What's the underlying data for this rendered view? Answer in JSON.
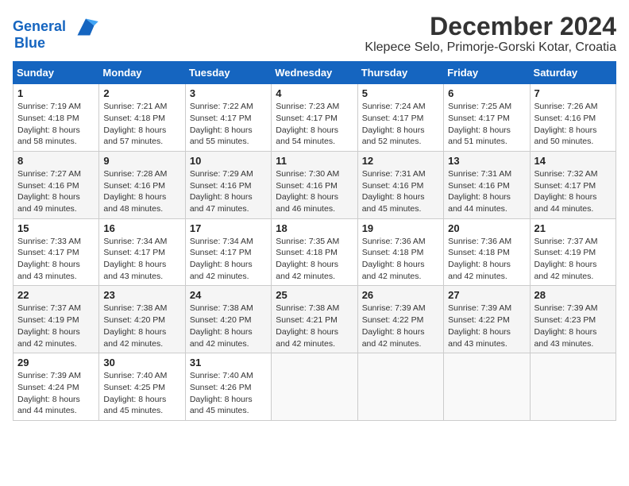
{
  "header": {
    "logo_line1": "General",
    "logo_line2": "Blue",
    "title": "December 2024",
    "subtitle": "Klepece Selo, Primorje-Gorski Kotar, Croatia"
  },
  "days_of_week": [
    "Sunday",
    "Monday",
    "Tuesday",
    "Wednesday",
    "Thursday",
    "Friday",
    "Saturday"
  ],
  "weeks": [
    [
      {
        "day": "1",
        "sunrise": "Sunrise: 7:19 AM",
        "sunset": "Sunset: 4:18 PM",
        "daylight": "Daylight: 8 hours and 58 minutes."
      },
      {
        "day": "2",
        "sunrise": "Sunrise: 7:21 AM",
        "sunset": "Sunset: 4:18 PM",
        "daylight": "Daylight: 8 hours and 57 minutes."
      },
      {
        "day": "3",
        "sunrise": "Sunrise: 7:22 AM",
        "sunset": "Sunset: 4:17 PM",
        "daylight": "Daylight: 8 hours and 55 minutes."
      },
      {
        "day": "4",
        "sunrise": "Sunrise: 7:23 AM",
        "sunset": "Sunset: 4:17 PM",
        "daylight": "Daylight: 8 hours and 54 minutes."
      },
      {
        "day": "5",
        "sunrise": "Sunrise: 7:24 AM",
        "sunset": "Sunset: 4:17 PM",
        "daylight": "Daylight: 8 hours and 52 minutes."
      },
      {
        "day": "6",
        "sunrise": "Sunrise: 7:25 AM",
        "sunset": "Sunset: 4:17 PM",
        "daylight": "Daylight: 8 hours and 51 minutes."
      },
      {
        "day": "7",
        "sunrise": "Sunrise: 7:26 AM",
        "sunset": "Sunset: 4:16 PM",
        "daylight": "Daylight: 8 hours and 50 minutes."
      }
    ],
    [
      {
        "day": "8",
        "sunrise": "Sunrise: 7:27 AM",
        "sunset": "Sunset: 4:16 PM",
        "daylight": "Daylight: 8 hours and 49 minutes."
      },
      {
        "day": "9",
        "sunrise": "Sunrise: 7:28 AM",
        "sunset": "Sunset: 4:16 PM",
        "daylight": "Daylight: 8 hours and 48 minutes."
      },
      {
        "day": "10",
        "sunrise": "Sunrise: 7:29 AM",
        "sunset": "Sunset: 4:16 PM",
        "daylight": "Daylight: 8 hours and 47 minutes."
      },
      {
        "day": "11",
        "sunrise": "Sunrise: 7:30 AM",
        "sunset": "Sunset: 4:16 PM",
        "daylight": "Daylight: 8 hours and 46 minutes."
      },
      {
        "day": "12",
        "sunrise": "Sunrise: 7:31 AM",
        "sunset": "Sunset: 4:16 PM",
        "daylight": "Daylight: 8 hours and 45 minutes."
      },
      {
        "day": "13",
        "sunrise": "Sunrise: 7:31 AM",
        "sunset": "Sunset: 4:16 PM",
        "daylight": "Daylight: 8 hours and 44 minutes."
      },
      {
        "day": "14",
        "sunrise": "Sunrise: 7:32 AM",
        "sunset": "Sunset: 4:17 PM",
        "daylight": "Daylight: 8 hours and 44 minutes."
      }
    ],
    [
      {
        "day": "15",
        "sunrise": "Sunrise: 7:33 AM",
        "sunset": "Sunset: 4:17 PM",
        "daylight": "Daylight: 8 hours and 43 minutes."
      },
      {
        "day": "16",
        "sunrise": "Sunrise: 7:34 AM",
        "sunset": "Sunset: 4:17 PM",
        "daylight": "Daylight: 8 hours and 43 minutes."
      },
      {
        "day": "17",
        "sunrise": "Sunrise: 7:34 AM",
        "sunset": "Sunset: 4:17 PM",
        "daylight": "Daylight: 8 hours and 42 minutes."
      },
      {
        "day": "18",
        "sunrise": "Sunrise: 7:35 AM",
        "sunset": "Sunset: 4:18 PM",
        "daylight": "Daylight: 8 hours and 42 minutes."
      },
      {
        "day": "19",
        "sunrise": "Sunrise: 7:36 AM",
        "sunset": "Sunset: 4:18 PM",
        "daylight": "Daylight: 8 hours and 42 minutes."
      },
      {
        "day": "20",
        "sunrise": "Sunrise: 7:36 AM",
        "sunset": "Sunset: 4:18 PM",
        "daylight": "Daylight: 8 hours and 42 minutes."
      },
      {
        "day": "21",
        "sunrise": "Sunrise: 7:37 AM",
        "sunset": "Sunset: 4:19 PM",
        "daylight": "Daylight: 8 hours and 42 minutes."
      }
    ],
    [
      {
        "day": "22",
        "sunrise": "Sunrise: 7:37 AM",
        "sunset": "Sunset: 4:19 PM",
        "daylight": "Daylight: 8 hours and 42 minutes."
      },
      {
        "day": "23",
        "sunrise": "Sunrise: 7:38 AM",
        "sunset": "Sunset: 4:20 PM",
        "daylight": "Daylight: 8 hours and 42 minutes."
      },
      {
        "day": "24",
        "sunrise": "Sunrise: 7:38 AM",
        "sunset": "Sunset: 4:20 PM",
        "daylight": "Daylight: 8 hours and 42 minutes."
      },
      {
        "day": "25",
        "sunrise": "Sunrise: 7:38 AM",
        "sunset": "Sunset: 4:21 PM",
        "daylight": "Daylight: 8 hours and 42 minutes."
      },
      {
        "day": "26",
        "sunrise": "Sunrise: 7:39 AM",
        "sunset": "Sunset: 4:22 PM",
        "daylight": "Daylight: 8 hours and 42 minutes."
      },
      {
        "day": "27",
        "sunrise": "Sunrise: 7:39 AM",
        "sunset": "Sunset: 4:22 PM",
        "daylight": "Daylight: 8 hours and 43 minutes."
      },
      {
        "day": "28",
        "sunrise": "Sunrise: 7:39 AM",
        "sunset": "Sunset: 4:23 PM",
        "daylight": "Daylight: 8 hours and 43 minutes."
      }
    ],
    [
      {
        "day": "29",
        "sunrise": "Sunrise: 7:39 AM",
        "sunset": "Sunset: 4:24 PM",
        "daylight": "Daylight: 8 hours and 44 minutes."
      },
      {
        "day": "30",
        "sunrise": "Sunrise: 7:40 AM",
        "sunset": "Sunset: 4:25 PM",
        "daylight": "Daylight: 8 hours and 45 minutes."
      },
      {
        "day": "31",
        "sunrise": "Sunrise: 7:40 AM",
        "sunset": "Sunset: 4:26 PM",
        "daylight": "Daylight: 8 hours and 45 minutes."
      },
      {
        "day": "",
        "sunrise": "",
        "sunset": "",
        "daylight": ""
      },
      {
        "day": "",
        "sunrise": "",
        "sunset": "",
        "daylight": ""
      },
      {
        "day": "",
        "sunrise": "",
        "sunset": "",
        "daylight": ""
      },
      {
        "day": "",
        "sunrise": "",
        "sunset": "",
        "daylight": ""
      }
    ]
  ]
}
